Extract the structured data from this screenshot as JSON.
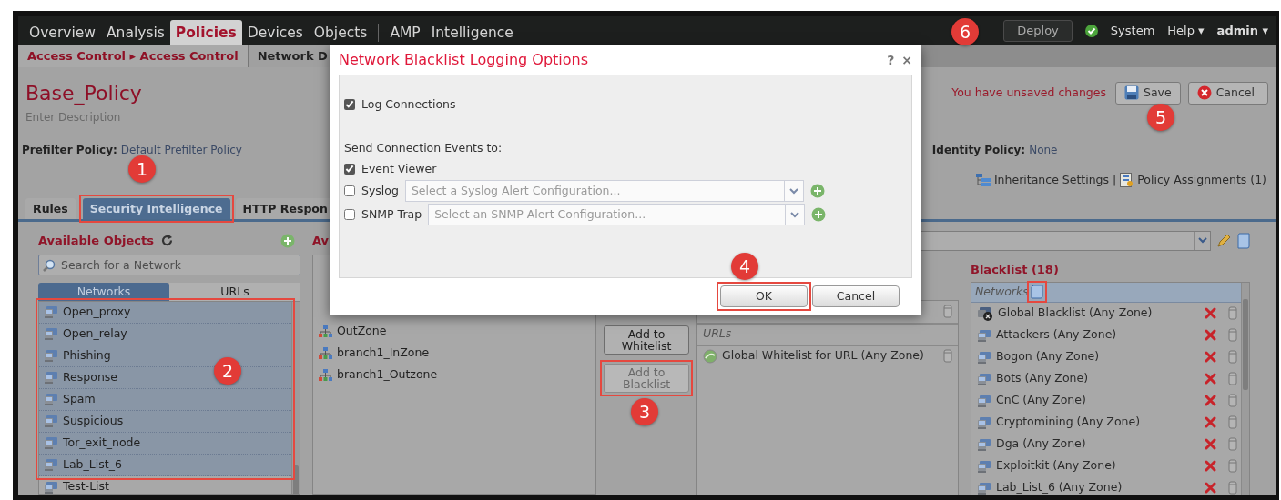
{
  "nav": {
    "primary": [
      {
        "label": "Overview",
        "selected": false
      },
      {
        "label": "Analysis",
        "selected": false
      },
      {
        "label": "Policies",
        "selected": true
      },
      {
        "label": "Devices",
        "selected": false
      },
      {
        "label": "Objects",
        "selected": false
      }
    ],
    "secondary": [
      {
        "label": "AMP",
        "selected": false
      },
      {
        "label": "Intelligence",
        "selected": false
      }
    ],
    "deploy": "Deploy",
    "health_ok": true,
    "menus": [
      {
        "label": "System"
      },
      {
        "label": "Help",
        "caret": "▾"
      },
      {
        "label": "admin",
        "caret": "▾"
      }
    ]
  },
  "subnav": [
    {
      "label": "Access Control ▸ Access Control",
      "selected": true
    },
    {
      "label": "Network D",
      "selected": false
    }
  ],
  "policy": {
    "title": "Base_Policy",
    "description": "Enter Description",
    "unsaved": "You have unsaved changes",
    "save": "Save",
    "cancel": "Cancel",
    "prefilter_label": "Prefilter Policy:",
    "prefilter_link": "Default Prefilter Policy",
    "identity_label": "Identity Policy:",
    "identity_link": "None",
    "inheritance": "Inheritance Settings",
    "separator": "|",
    "assignments": "Policy Assignments (1)"
  },
  "tabs": [
    {
      "label": "Rules",
      "selected": false
    },
    {
      "label": "Security Intelligence",
      "selected": true
    },
    {
      "label": "HTTP Respon",
      "selected": false
    }
  ],
  "available": {
    "title": "Available Objects",
    "search_placeholder": "Search for a Network",
    "tabs": [
      {
        "label": "Networks",
        "selected": true
      },
      {
        "label": "URLs",
        "selected": false
      }
    ],
    "rows": [
      {
        "label": "Open_proxy",
        "selected": true
      },
      {
        "label": "Open_relay",
        "selected": true
      },
      {
        "label": "Phishing",
        "selected": true
      },
      {
        "label": "Response",
        "selected": true
      },
      {
        "label": "Spam",
        "selected": true
      },
      {
        "label": "Suspicious",
        "selected": true
      },
      {
        "label": "Tor_exit_node",
        "selected": true
      },
      {
        "label": "Lab_List_6",
        "selected": true
      },
      {
        "label": "Test-List",
        "selected": false
      }
    ]
  },
  "zones": {
    "title": "Av",
    "rows": [
      "OutZone",
      "branch1_InZone",
      "branch1_Outzone"
    ]
  },
  "actions": [
    {
      "label": "Add to Whitelist",
      "disabled": false
    },
    {
      "label": "Add to Blacklist",
      "disabled": true
    }
  ],
  "whitelist": {
    "section": "URLs",
    "rows": [
      {
        "label": "Global Whitelist for URL (Any Zone)"
      }
    ]
  },
  "blacklist": {
    "title": "Blacklist (18)",
    "section": "Networks",
    "rows": [
      {
        "label": "Global Blacklist (Any Zone)",
        "kind": "global"
      },
      {
        "label": "Attackers (Any Zone)",
        "kind": "network"
      },
      {
        "label": "Bogon (Any Zone)",
        "kind": "network"
      },
      {
        "label": "Bots (Any Zone)",
        "kind": "network"
      },
      {
        "label": "CnC (Any Zone)",
        "kind": "network"
      },
      {
        "label": "Cryptomining (Any Zone)",
        "kind": "network"
      },
      {
        "label": "Dga (Any Zone)",
        "kind": "network"
      },
      {
        "label": "Exploitkit (Any Zone)",
        "kind": "network"
      },
      {
        "label": "Lab_List_6 (Any Zone)",
        "kind": "network"
      }
    ]
  },
  "dialog": {
    "title": "Network Blacklist Logging Options",
    "help": "?",
    "close": "×",
    "log_connections": {
      "label": "Log Connections",
      "checked": true
    },
    "send_label": "Send Connection Events to:",
    "targets": [
      {
        "label": "Event Viewer",
        "checked": true
      },
      {
        "label": "Syslog",
        "checked": false,
        "placeholder": "Select a Syslog Alert Configuration..."
      },
      {
        "label": "SNMP Trap",
        "checked": false,
        "placeholder": "Select an SNMP Alert Configuration..."
      }
    ],
    "ok": "OK",
    "cancel": "Cancel"
  },
  "annotations": [
    {
      "kind": "marker",
      "text": "1"
    },
    {
      "kind": "marker",
      "text": "2"
    },
    {
      "kind": "marker",
      "text": "3"
    },
    {
      "kind": "marker",
      "text": "4"
    },
    {
      "kind": "marker",
      "text": "5"
    },
    {
      "kind": "marker",
      "text": "6"
    },
    {
      "kind": "frame"
    },
    {
      "kind": "frame"
    },
    {
      "kind": "frame"
    },
    {
      "kind": "frame"
    },
    {
      "kind": "frame"
    }
  ]
}
